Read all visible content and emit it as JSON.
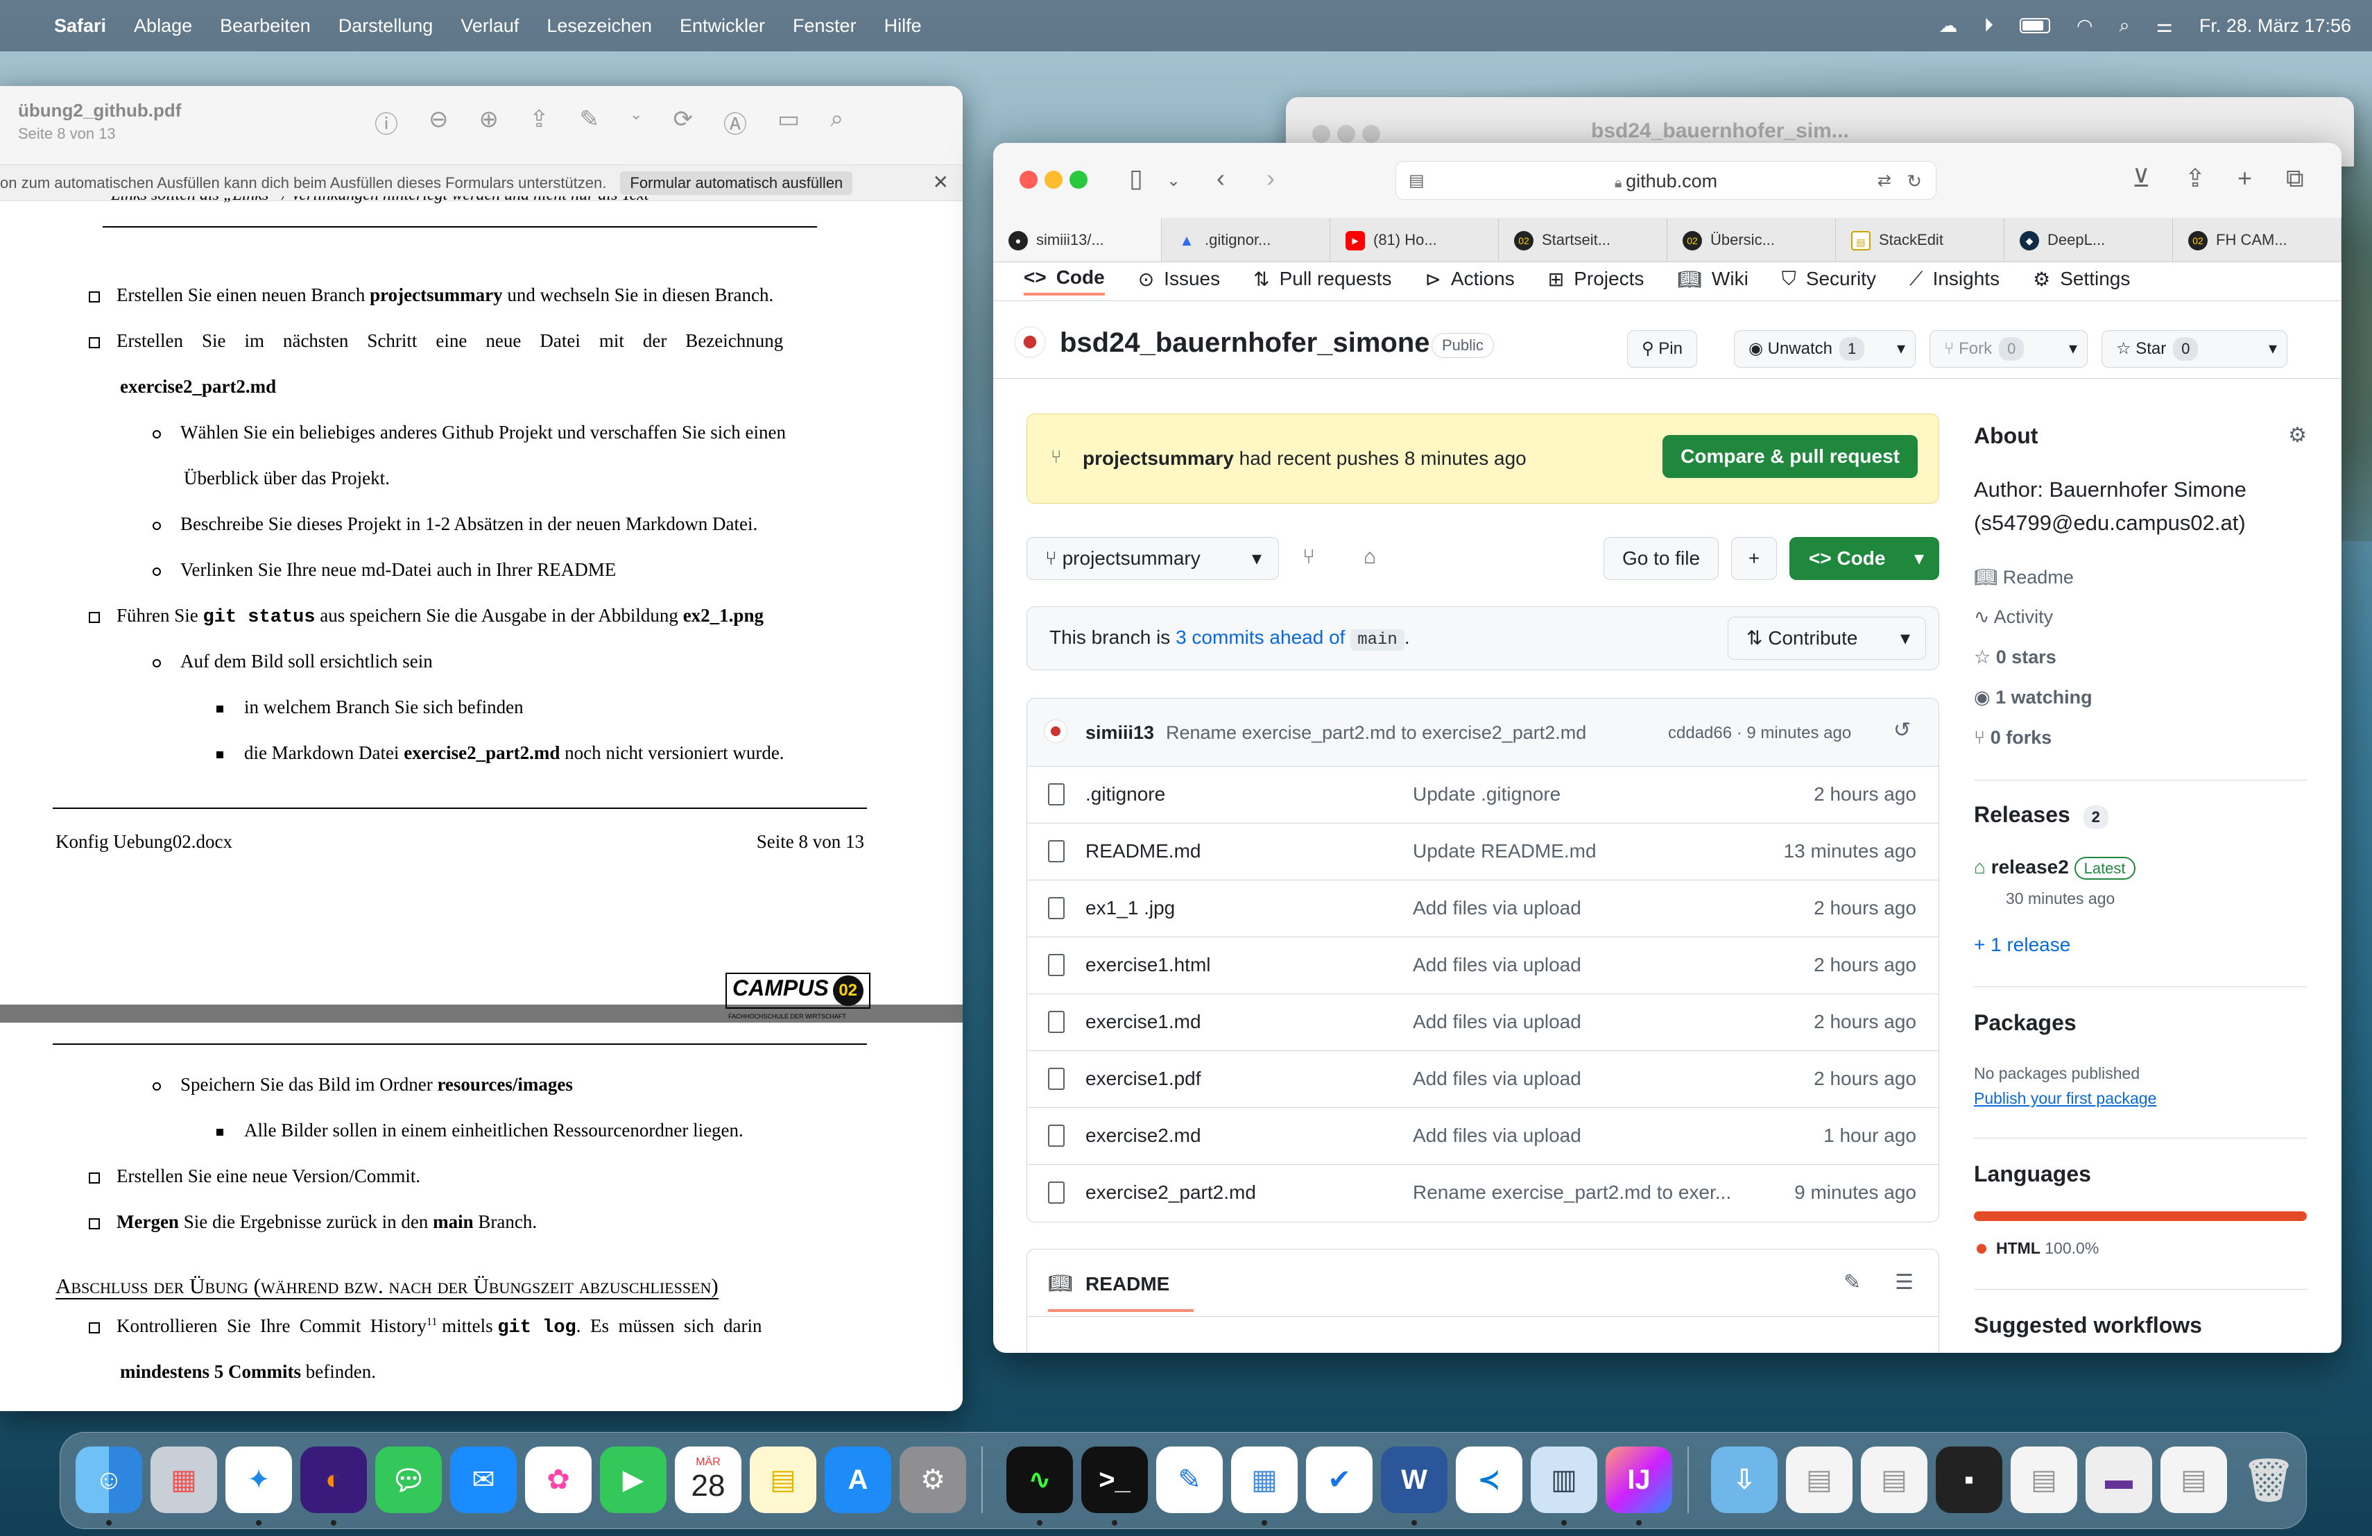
{
  "menubar": {
    "app": "Safari",
    "items": [
      "Ablage",
      "Bearbeiten",
      "Darstellung",
      "Verlauf",
      "Lesezeichen",
      "Entwickler",
      "Fenster",
      "Hilfe"
    ],
    "clock": "Fr. 28. März  17:56"
  },
  "pdf": {
    "title": "übung2_github.pdf",
    "subtitle": "Seite 8 von 13",
    "autofill_text": "on zum automatischen Ausfüllen kann dich beim Ausfüllen dieses Formulars unterstützen.",
    "autofill_button": "Formular automatisch ausfüllen",
    "cut_line": "Links sollten als „Links“ / Verlinkungen hinterlegt werden und nicht nur als Text",
    "l1a": "Erstellen Sie einen neuen Branch ",
    "l1b": "projectsummary",
    "l1c": " und wechseln Sie in diesen Branch.",
    "l2": "Erstellen    Sie    im    nächsten    Schritt    eine    neue    Datei    mit    der    Bezeichnung",
    "l2b": "exercise2_part2.md",
    "l3": "Wählen Sie ein beliebiges anderes Github Projekt und verschaffen Sie sich einen",
    "l3b": "Überblick über das Projekt.",
    "l4": "Beschreibe Sie dieses Projekt in 1-2 Absätzen in der neuen Markdown Datei.",
    "l5": "Verlinken Sie Ihre neue md-Datei auch in Ihrer README",
    "l6a": "Führen Sie ",
    "l6b": "git status",
    "l6c": " aus speichern Sie die Ausgabe in der Abbildung ",
    "l6d": "ex2_1.png",
    "l7": "Auf dem Bild soll ersichtlich sein",
    "l8": "in welchem Branch Sie sich befinden",
    "l9a": "die Markdown Datei ",
    "l9b": "exercise2_part2.md",
    "l9c": " noch nicht versioniert wurde.",
    "footer_left": "Konfig Uebung02.docx",
    "footer_right": "Seite 8 von 13",
    "logo": "CAMPUS",
    "logo_badge": "02",
    "logo_sub": "FACHHOCHSCHULE DER WIRTSCHAFT",
    "p2a": "Speichern Sie das Bild im Ordner ",
    "p2b": "resources/images",
    "p3": "Alle Bilder sollen in einem einheitlichen Ressourcenordner liegen.",
    "p4": "Erstellen Sie eine neue Version/Commit.",
    "p5a": "Mergen",
    "p5b": " Sie die Ergebnisse zurück in den ",
    "p5c": "main",
    "p5d": " Branch.",
    "heading": "Abschluss der Übung (während bzw. nach der Übungszeit abzuschließen)",
    "p6a": "Kontrollieren  Sie  Ihre  Commit  History",
    "p6sup": "11",
    "p6b": " mittels ",
    "p6c": "git log",
    "p6d": ".  Es  müssen  sich  darin",
    "p7a": "mindestens 5 Commits",
    "p7b": " befinden."
  },
  "back_window": {
    "title": "bsd24_bauernhofer_sim..."
  },
  "browser": {
    "url": "github.com",
    "tabs": [
      "simiii13/...",
      ".gitignor...",
      "(81) Ho...",
      "Startseit...",
      "Übersic...",
      "StackEdit",
      "DeepL...",
      "FH CAM..."
    ]
  },
  "github": {
    "nav": [
      "Code",
      "Issues",
      "Pull requests",
      "Actions",
      "Projects",
      "Wiki",
      "Security",
      "Insights",
      "Settings"
    ],
    "repo": "bsd24_bauernhofer_simone",
    "visibility": "Public",
    "pin": "Pin",
    "unwatch": "Unwatch",
    "unwatch_count": "1",
    "fork": "Fork",
    "fork_count": "0",
    "star": "Star",
    "star_count": "0",
    "banner_branch": "projectsummary",
    "banner_text": " had recent pushes 8 minutes ago",
    "compare": "Compare & pull request",
    "branch": "projectsummary",
    "goto": "Go to file",
    "plus": "+",
    "code": "Code",
    "ahead_a": "This branch is ",
    "ahead_link": "3 commits ahead of",
    "ahead_main": "main",
    "ahead_dot": ".",
    "contribute": "Contribute",
    "commit_user": "simiii13",
    "commit_msg": "Rename exercise_part2.md to exercise2_part2.md",
    "commit_meta": "cddad66 · 9 minutes ago",
    "files": [
      {
        "name": ".gitignore",
        "msg": "Update .gitignore",
        "time": "2 hours ago"
      },
      {
        "name": "README.md",
        "msg": "Update README.md",
        "time": "13 minutes ago"
      },
      {
        "name": "ex1_1 .jpg",
        "msg": "Add files via upload",
        "time": "2 hours ago"
      },
      {
        "name": "exercise1.html",
        "msg": "Add files via upload",
        "time": "2 hours ago"
      },
      {
        "name": "exercise1.md",
        "msg": "Add files via upload",
        "time": "2 hours ago"
      },
      {
        "name": "exercise1.pdf",
        "msg": "Add files via upload",
        "time": "2 hours ago"
      },
      {
        "name": "exercise2.md",
        "msg": "Add files via upload",
        "time": "1 hour ago"
      },
      {
        "name": "exercise2_part2.md",
        "msg": "Rename exercise_part2.md to exer...",
        "time": "9 minutes ago"
      }
    ],
    "readme": "README",
    "about": "About",
    "author1": "Author: Bauernhofer Simone",
    "author2": "(s54799@edu.campus02.at)",
    "side_links": [
      "Readme",
      "Activity",
      "0 stars",
      "1 watching",
      "0 forks"
    ],
    "releases": "Releases",
    "releases_count": "2",
    "release_name": "release2",
    "latest": "Latest",
    "release_time": "30 minutes ago",
    "more_release": "+ 1 release",
    "packages": "Packages",
    "no_packages": "No packages published",
    "publish": "Publish your first package",
    "languages": "Languages",
    "lang": "HTML",
    "lang_pct": "100.0%",
    "suggested": "Suggested workflows"
  },
  "dock": {
    "calendar_month": "MÄR",
    "calendar_day": "28"
  },
  "colors": {
    "accent": "#1f883d",
    "link": "#0969da",
    "lang_bar": "#e34c26"
  }
}
